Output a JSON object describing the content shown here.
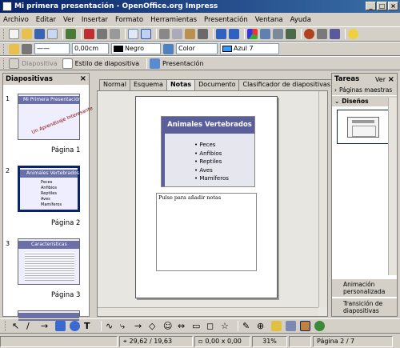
{
  "window": {
    "title": "Mi primera presentación - OpenOffice.org Impress"
  },
  "menu": [
    "Archivo",
    "Editar",
    "Ver",
    "Insertar",
    "Formato",
    "Herramientas",
    "Presentación",
    "Ventana",
    "Ayuda"
  ],
  "toolbar2": {
    "line_width": "0,00cm",
    "line_color": "Negro",
    "fill_type": "Color",
    "fill_color": "Azul 7"
  },
  "toolbar3": {
    "slide_btn": "Diapositiva",
    "style_btn": "Estilo de diapositiva",
    "presentation_btn": "Presentación"
  },
  "left_panel": {
    "title": "Diapositivas",
    "slides": [
      {
        "num": "1",
        "label": "Página 1",
        "title": "Mi Primera Presentación",
        "subtitle": "Un Aprendizaje Interesante"
      },
      {
        "num": "2",
        "label": "Página 2",
        "title": "Animales Vertebrados",
        "bullets": [
          "Peces",
          "Anfibios",
          "Reptiles",
          "Aves",
          "Mamíferos"
        ]
      },
      {
        "num": "3",
        "label": "Página 3",
        "title": "Características"
      }
    ]
  },
  "tabs": [
    "Normal",
    "Esquema",
    "Notas",
    "Documento",
    "Clasificador de diapositivas"
  ],
  "active_tab": "Notas",
  "notes_page": {
    "slide_title": "Animales Vertebrados",
    "bullets": [
      "Peces",
      "Anfibios",
      "Reptiles",
      "Aves",
      "Mamíferos"
    ],
    "notes_placeholder": "Pulse para añadir notas"
  },
  "right_panel": {
    "title": "Tareas",
    "view_label": "Ver",
    "sections": [
      "Páginas maestras",
      "Diseños"
    ],
    "bottom_sections": [
      "Animación personalizada",
      "Transición de diapositivas"
    ]
  },
  "status": {
    "position": "29,62 / 19,63",
    "size": "0,00 x 0,00",
    "zoom": "31%",
    "page": "Página 2 / 7"
  },
  "colors": {
    "title_band": "#5a5f9a",
    "accent": "#0a246a"
  }
}
